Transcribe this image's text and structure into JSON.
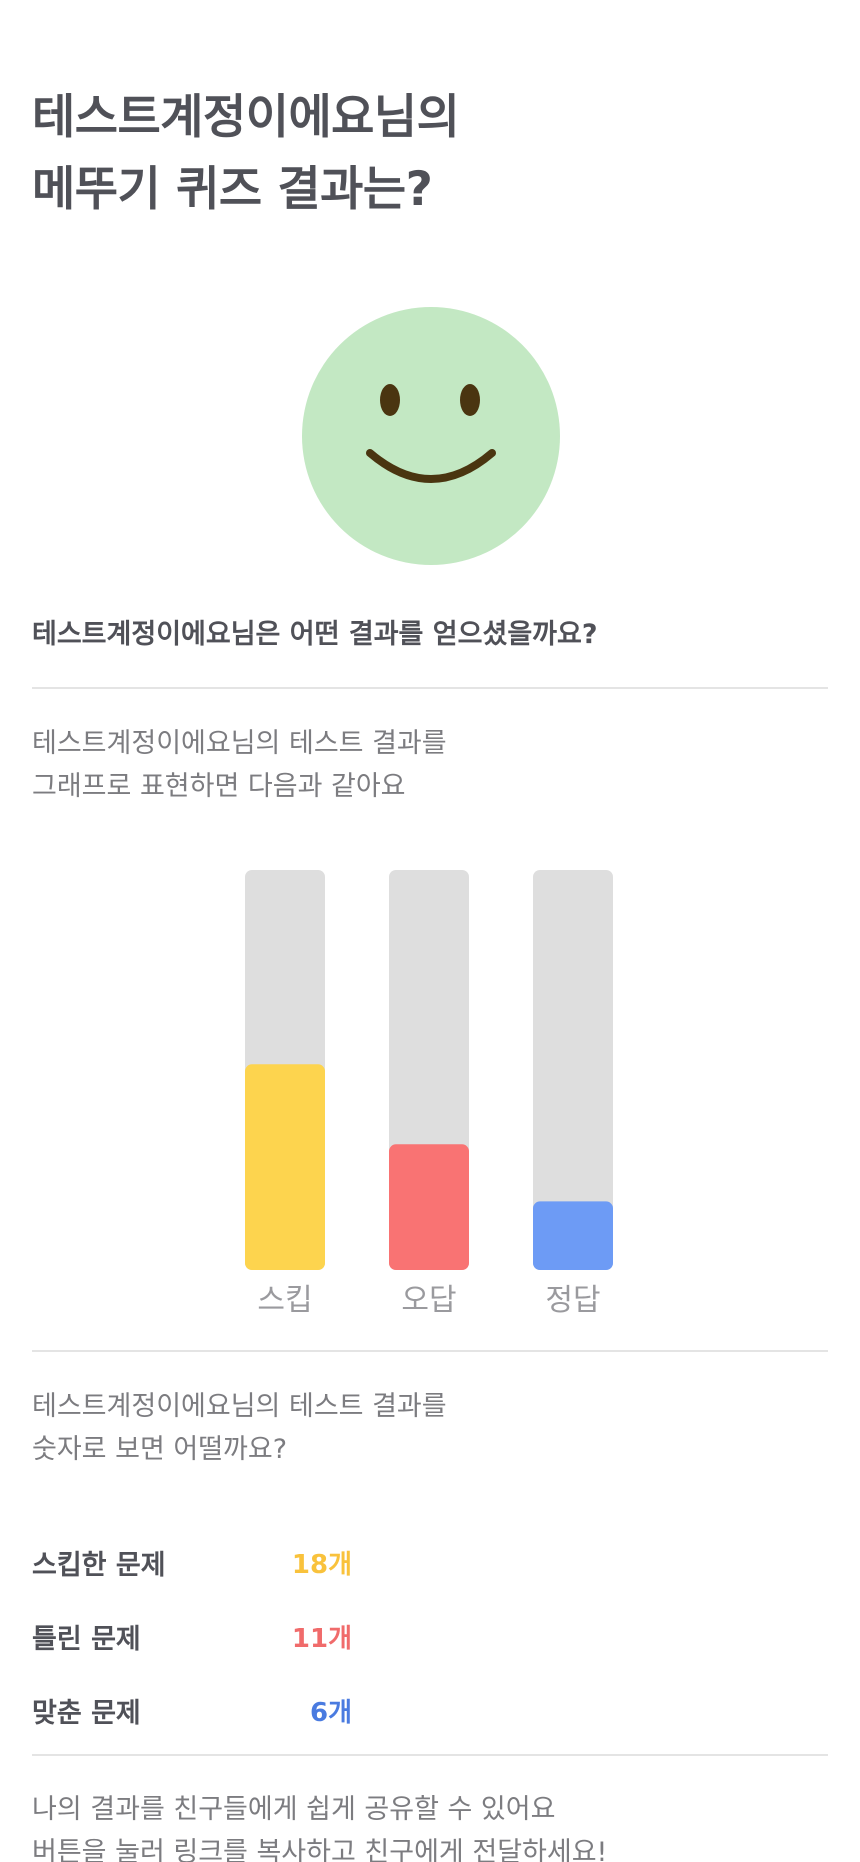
{
  "header": {
    "title_line1": "테스트계정이에요님의",
    "title_line2": "메뚜기 퀴즈 결과는?"
  },
  "result_icon": {
    "name": "smiley-face-icon",
    "color": "#c3e8c3",
    "feature_color": "#4a3510"
  },
  "question": "테스트계정이에요님은 어떤 결과를 얻으셨을까요?",
  "graph_section": {
    "desc_line1": "테스트계정이에요님의 테스트 결과를",
    "desc_line2": "그래프로 표현하면 다음과 같아요"
  },
  "chart_data": {
    "type": "bar",
    "categories": [
      "스킵",
      "오답",
      "정답"
    ],
    "values": [
      18,
      11,
      6
    ],
    "ylim": [
      0,
      35
    ],
    "colors": [
      "#fdd44e",
      "#f97373",
      "#6d9bf5"
    ],
    "track_color": "#dedede",
    "grid": false
  },
  "number_section": {
    "desc_line1": "테스트계정이에요님의 테스트 결과를",
    "desc_line2": "숫자로 보면 어떨까요?"
  },
  "stats": [
    {
      "label": "스킵한 문제",
      "value": "18개",
      "color": "#f9c23c"
    },
    {
      "label": "틀린 문제",
      "value": "11개",
      "color": "#f06b6b"
    },
    {
      "label": "맞춘 문제",
      "value": "6개",
      "color": "#4a7be0"
    }
  ],
  "share": {
    "line1": "나의 결과를 친구들에게 쉽게 공유할 수 있어요",
    "line2": "버튼을 눌러 링크를 복사하고 친구에게 전달하세요!"
  }
}
